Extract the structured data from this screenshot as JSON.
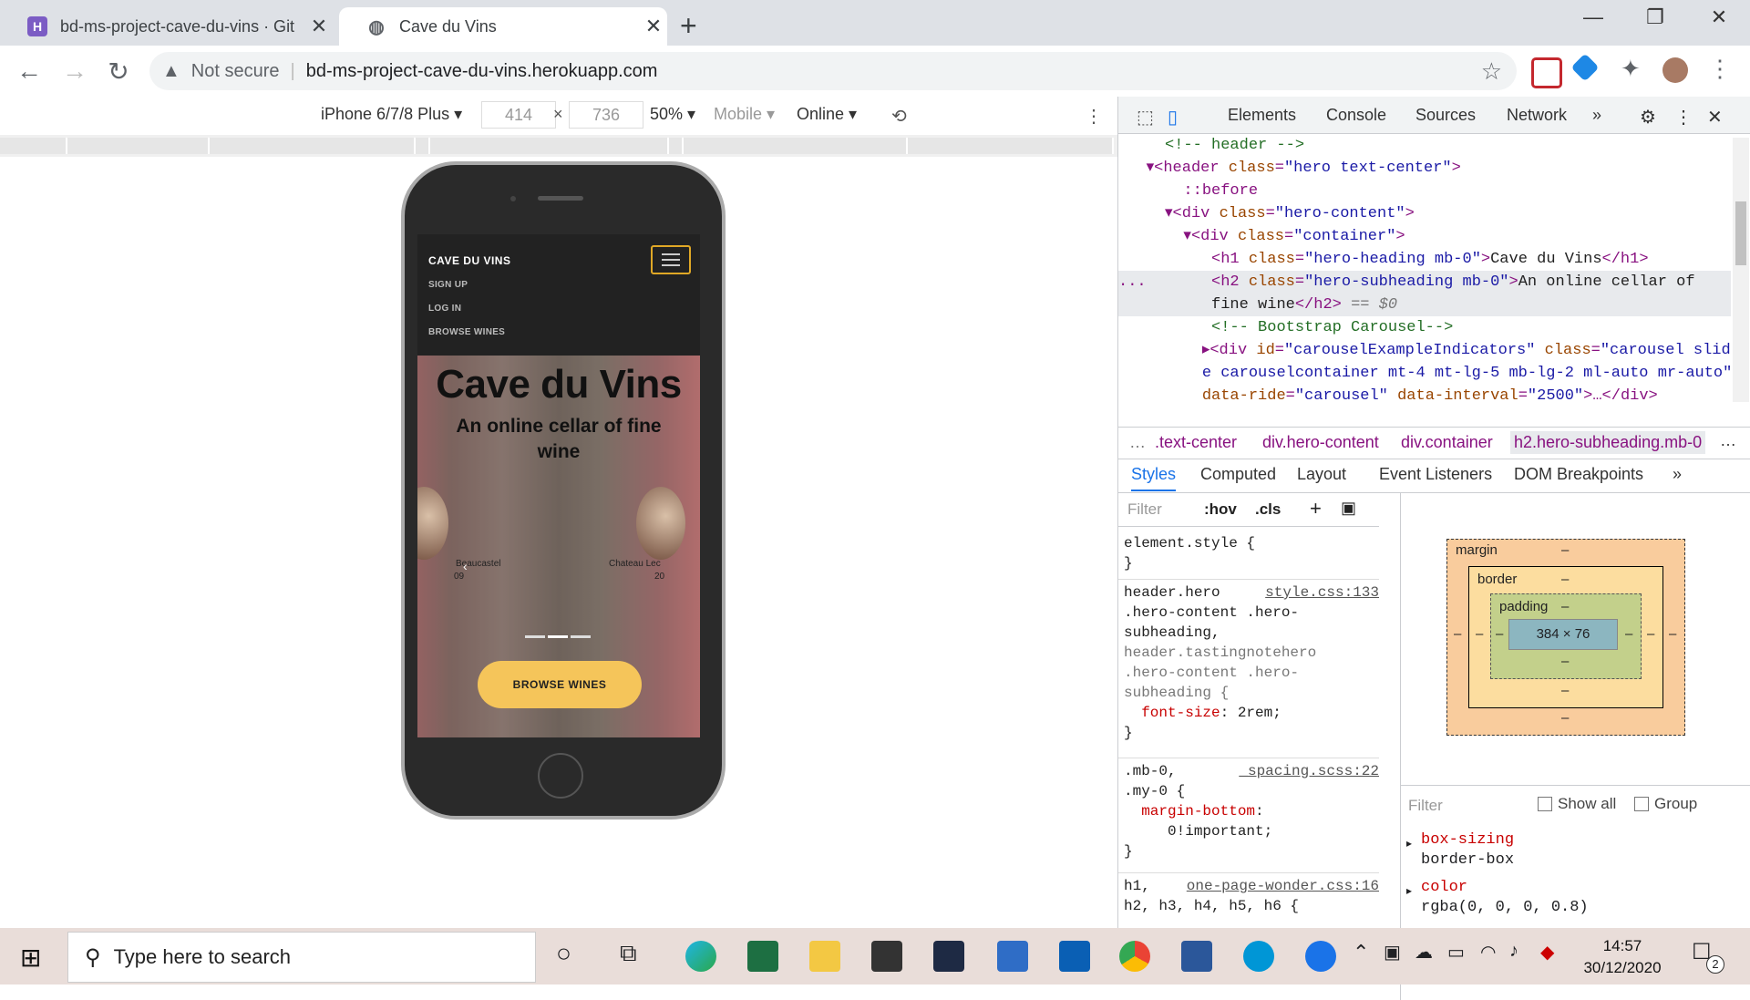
{
  "browser": {
    "tabs": [
      {
        "title": "bd-ms-project-cave-du-vins · Git",
        "favicon": "heroku-icon"
      },
      {
        "title": "Cave du Vins",
        "favicon": "globe-icon"
      }
    ],
    "address": {
      "security": "Not secure",
      "url": "bd-ms-project-cave-du-vins.herokuapp.com"
    }
  },
  "device_toolbar": {
    "device": "iPhone 6/7/8 Plus",
    "width": "414",
    "height": "736",
    "zoom": "50%",
    "type": "Mobile",
    "throttle": "Online"
  },
  "site": {
    "brand": "CAVE DU VINS",
    "nav_links": [
      "SIGN UP",
      "LOG IN",
      "BROWSE WINES"
    ],
    "hero_heading": "Cave du Vins",
    "hero_subheading": "An online cellar of fine wine",
    "carousel": [
      {
        "label": "Beaucastel",
        "sub": "09"
      },
      {
        "label": "Chateau Lec",
        "sub": "20"
      }
    ],
    "cta": "BROWSE WINES"
  },
  "devtools": {
    "tabs": [
      "Elements",
      "Console",
      "Sources",
      "Network"
    ],
    "crumbs": [
      ".text-center",
      "div.hero-content",
      "div.container",
      "h2.hero-subheading.mb-0"
    ],
    "subtabs": [
      "Styles",
      "Computed",
      "Layout",
      "Event Listeners",
      "DOM Breakpoints"
    ],
    "filter_placeholder": "Filter",
    "hov": ":hov",
    "cls": ".cls",
    "box_model": {
      "margin": "margin",
      "border": "border",
      "padding": "padding",
      "content": "384 × 76",
      "dash": "–"
    },
    "computed_filter": "Filter",
    "show_all": "Show all",
    "group": "Group",
    "computed_props": [
      {
        "name": "box-sizing",
        "value": "border-box"
      },
      {
        "name": "color",
        "value": "rgba(0, 0, 0, 0.8)"
      }
    ]
  },
  "taskbar": {
    "search_placeholder": "Type here to search",
    "time": "14:57",
    "date": "30/12/2020",
    "notifications": "2"
  }
}
